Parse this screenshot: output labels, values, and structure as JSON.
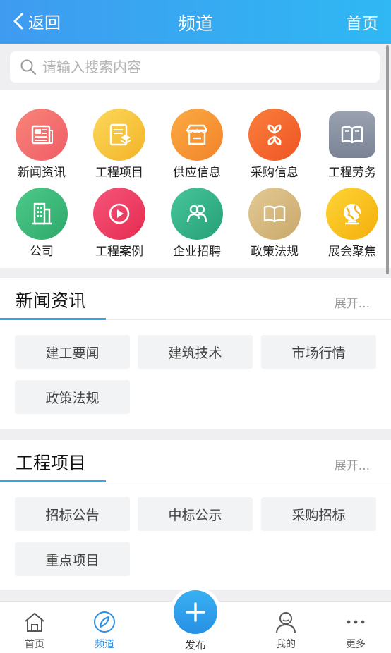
{
  "header": {
    "back_label": "返回",
    "title": "频道",
    "home_label": "首页"
  },
  "search": {
    "placeholder": "请输入搜索内容"
  },
  "channels": [
    {
      "label": "新闻资讯",
      "icon": "newspaper-icon",
      "color": "#f46b6b"
    },
    {
      "label": "工程项目",
      "icon": "document-stack-icon",
      "color": "#f5c33b"
    },
    {
      "label": "供应信息",
      "icon": "store-icon",
      "color": "#f5902e"
    },
    {
      "label": "采购信息",
      "icon": "flower-icon",
      "color": "#f4692a"
    },
    {
      "label": "工程劳务",
      "icon": "book-icon",
      "color": "#8a93a3"
    },
    {
      "label": "公司",
      "icon": "building-icon",
      "color": "#3cbb7a"
    },
    {
      "label": "工程案例",
      "icon": "play-icon",
      "color": "#ef3c5f"
    },
    {
      "label": "企业招聘",
      "icon": "people-icon",
      "color": "#36b68a"
    },
    {
      "label": "政策法规",
      "icon": "book-open-icon",
      "color": "#d7bb80"
    },
    {
      "label": "展会聚焦",
      "icon": "globe-icon",
      "color": "#f6c317"
    }
  ],
  "sections": [
    {
      "title": "新闻资讯",
      "expand_label": "展开...",
      "tags": [
        "建工要闻",
        "建筑技术",
        "市场行情",
        "政策法规"
      ]
    },
    {
      "title": "工程项目",
      "expand_label": "展开...",
      "tags": [
        "招标公告",
        "中标公示",
        "采购招标",
        "重点项目"
      ]
    }
  ],
  "tabbar": {
    "home": "首页",
    "channel": "频道",
    "publish": "发布",
    "mine": "我的",
    "more": "更多"
  },
  "colors": {
    "accent": "#2ea7ea",
    "header_start": "#3f9bf0",
    "header_end": "#2fb8f3"
  }
}
